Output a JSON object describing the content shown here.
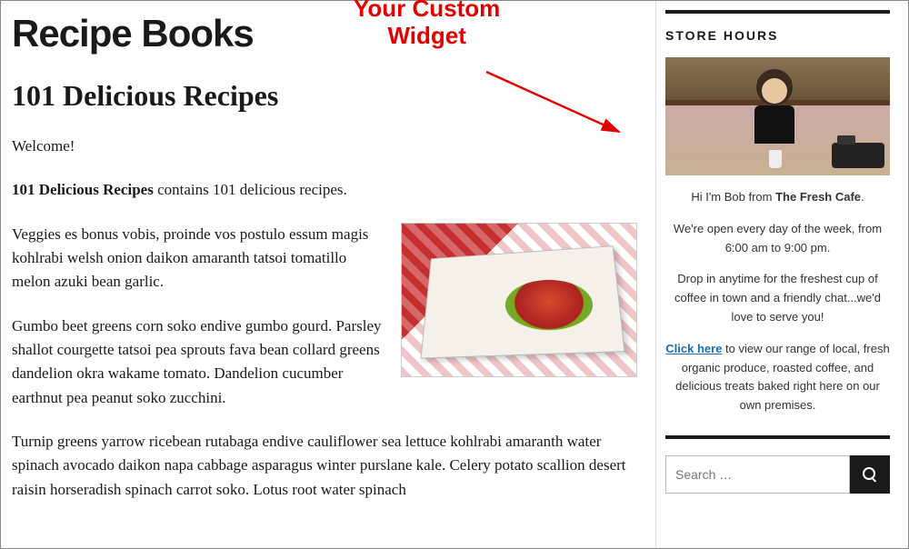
{
  "annotation": {
    "line1": "Your Custom",
    "line2": "Widget"
  },
  "main": {
    "page_title": "Recipe Books",
    "post_title": "101 Delicious Recipes",
    "p1": "Welcome!",
    "p2_strong": "101 Delicious Recipes",
    "p2_rest": " contains 101 delicious recipes.",
    "p3": "Veggies es bonus vobis, proinde vos postulo essum magis kohlrabi welsh onion daikon amaranth tatsoi tomatillo melon azuki bean garlic.",
    "p4": "Gumbo beet greens corn soko endive gumbo gourd. Parsley shallot courgette tatsoi pea sprouts fava bean collard greens dandelion okra wakame tomato. Dandelion cucumber earthnut pea peanut soko zucchini.",
    "p5": "Turnip greens yarrow ricebean rutabaga endive cauliflower sea lettuce kohlrabi amaranth water spinach avocado daikon napa cabbage asparagus winter purslane kale. Celery potato scallion desert raisin horseradish spinach carrot soko. Lotus root water spinach"
  },
  "sidebar": {
    "store_hours": {
      "title": "STORE HOURS",
      "intro_pre": "Hi I'm Bob from ",
      "intro_bold": "The Fresh Cafe",
      "intro_post": ".",
      "hours": "We're open every day of the week, from 6:00 am to 9:00 pm.",
      "drop_in": "Drop in anytime for the freshest cup of coffee in town and a friendly chat...we'd love to serve you!",
      "cta_link": "Click here",
      "cta_rest": " to view our range of local, fresh organic produce, roasted coffee, and delicious treats baked right here on our own premises."
    },
    "search": {
      "placeholder": "Search …"
    }
  }
}
